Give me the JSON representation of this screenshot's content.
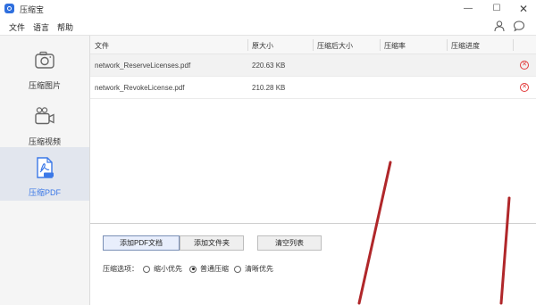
{
  "window": {
    "title": "压缩宝",
    "minimize_glyph": "—",
    "maximize_glyph": "☐",
    "close_glyph": "✕"
  },
  "menu": {
    "file": "文件",
    "language": "语言",
    "help": "帮助",
    "user_icon": "user-icon",
    "chat_icon": "chat-icon"
  },
  "sidebar": {
    "items": [
      {
        "label": "压缩图片",
        "icon": "camera-icon",
        "active": false
      },
      {
        "label": "压缩视频",
        "icon": "video-camera-icon",
        "active": false
      },
      {
        "label": "压缩PDF",
        "icon": "pdf-icon",
        "active": true
      }
    ]
  },
  "table": {
    "headers": {
      "file": "文件",
      "original_size": "原大小",
      "compressed_size": "压缩后大小",
      "ratio": "压缩率",
      "progress": "压缩进度"
    },
    "rows": [
      {
        "name": "network_ReserveLicenses.pdf",
        "size": "220.63 KB",
        "compressed_size": "",
        "ratio": "",
        "progress": ""
      },
      {
        "name": "network_RevokeLicense.pdf",
        "size": "210.28 KB",
        "compressed_size": "",
        "ratio": "",
        "progress": ""
      }
    ],
    "delete_glyph": "✕"
  },
  "actions": {
    "add_pdf": "添加PDF文档",
    "add_folder": "添加文件夹",
    "clear_list": "清空列表"
  },
  "options": {
    "label": "压缩选项：",
    "choices": [
      {
        "label": "缩小优先",
        "selected": false
      },
      {
        "label": "普通压缩",
        "selected": true
      },
      {
        "label": "清晰优先",
        "selected": false
      }
    ]
  },
  "colors": {
    "accent": "#3b78e7",
    "delete": "#e23b3b",
    "annotation": "#b0272a"
  }
}
